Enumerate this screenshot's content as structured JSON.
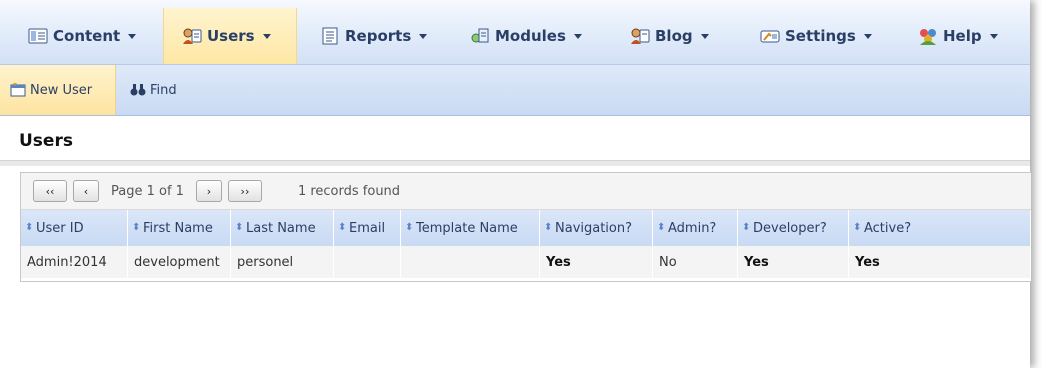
{
  "menu": [
    {
      "label": "Content",
      "icon": "content-icon",
      "active": false
    },
    {
      "label": "Users",
      "icon": "users-icon",
      "active": true
    },
    {
      "label": "Reports",
      "icon": "reports-icon",
      "active": false
    },
    {
      "label": "Modules",
      "icon": "modules-icon",
      "active": false
    },
    {
      "label": "Blog",
      "icon": "blog-icon",
      "active": false
    },
    {
      "label": "Settings",
      "icon": "settings-icon",
      "active": false
    },
    {
      "label": "Help",
      "icon": "help-icon",
      "active": false
    }
  ],
  "toolbar": {
    "new_user_label": "New User",
    "find_label": "Find"
  },
  "page_title": "Users",
  "pager": {
    "first": "‹‹",
    "prev": "‹",
    "next": "›",
    "last": "››",
    "page_text": "Page 1 of 1",
    "records_text": "1 records found"
  },
  "columns": [
    "User ID",
    "First Name",
    "Last Name",
    "Email",
    "Template Name",
    "Navigation?",
    "Admin?",
    "Developer?",
    "Active?"
  ],
  "rows": [
    [
      "Admin!2014",
      "development",
      "personel",
      "",
      "",
      "Yes",
      "No",
      "Yes",
      "Yes"
    ]
  ],
  "colors": {
    "accent": "#fde7a4",
    "header": "#c8daf4",
    "menu_text": "#2a3f66"
  }
}
